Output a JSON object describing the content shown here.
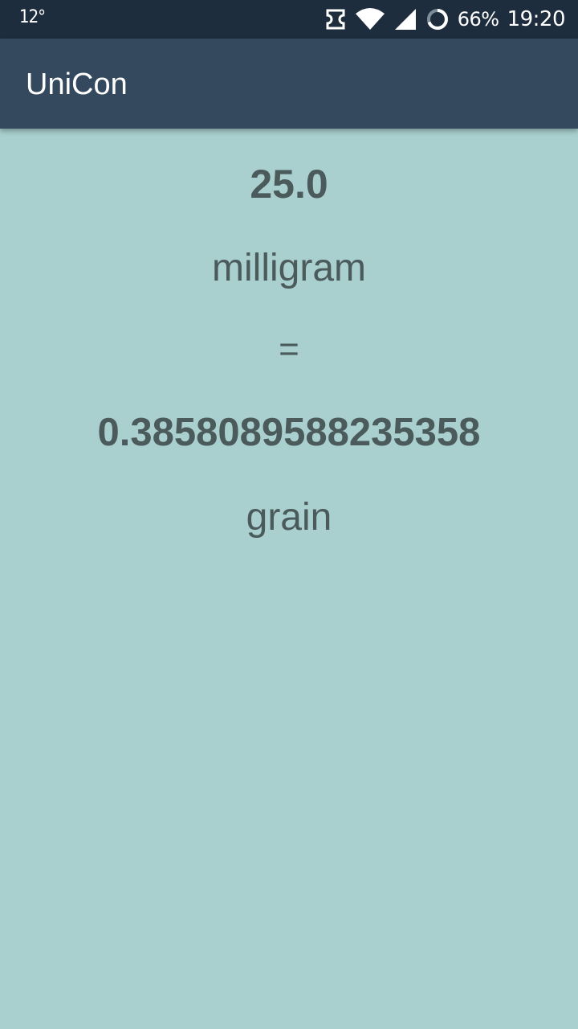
{
  "status_bar": {
    "temperature": "12°",
    "battery_percent": "66%",
    "time": "19:20",
    "icons": [
      "nfc-icon",
      "wifi-icon",
      "cell-signal-icon",
      "battery-icon"
    ]
  },
  "app_bar": {
    "title": "UniCon"
  },
  "conversion": {
    "input_value": "25.0",
    "input_unit": "milligram",
    "equals_sign": "=",
    "output_value": "0.3858089588235358",
    "output_unit": "grain"
  },
  "colors": {
    "status_bar_bg": "#1e2d3e",
    "app_bar_bg": "#34495e",
    "content_bg": "#a9cfcf",
    "text": "#4b5a5b"
  }
}
